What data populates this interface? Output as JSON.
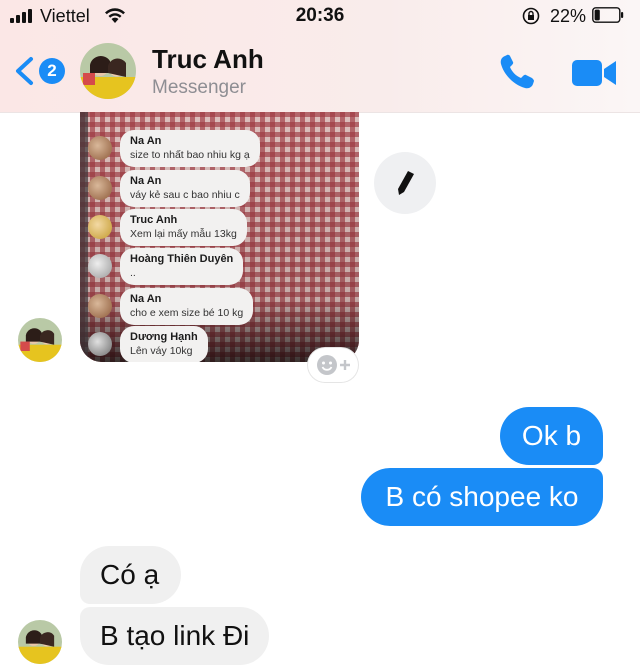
{
  "status_bar": {
    "carrier": "Viettel",
    "time": "20:36",
    "battery": "22%",
    "battery_level": 0.22
  },
  "header": {
    "unread_count": "2",
    "contact_name": "Truc Anh",
    "subtitle": "Messenger",
    "icons": [
      "back-chevron-icon",
      "phone-icon",
      "video-camera-icon"
    ],
    "accent_color": "#1a8cf6"
  },
  "shared_photo": {
    "comments": [
      {
        "name": "Na An",
        "text": "size to nhất bao nhiu kg ạ"
      },
      {
        "name": "Na An",
        "text": "váy kẻ sau c bao nhiu c"
      },
      {
        "name": "Truc Anh",
        "text": "Xem lại mấy mẫu  13kg"
      },
      {
        "name": "Hoàng Thiên Duyên",
        "text": ".."
      },
      {
        "name": "Na An",
        "text": "cho e xem size bé 10 kg"
      },
      {
        "name": "Dương Hạnh",
        "text": "Lên váy 10kg"
      }
    ]
  },
  "actions": {
    "edit_icon": "pencil-icon",
    "react_icon": "add-reaction-icon"
  },
  "messages": [
    {
      "direction": "outgoing",
      "text": "Ok b"
    },
    {
      "direction": "outgoing",
      "text": "B có shopee ko"
    },
    {
      "direction": "incoming",
      "text": "Có ạ"
    },
    {
      "direction": "incoming",
      "text": "B tạo link Đi"
    }
  ],
  "colors": {
    "outgoing_bubble": "#1a8cf6",
    "incoming_bubble": "#f0f0f0",
    "header_bg": "#fbe7e6"
  }
}
